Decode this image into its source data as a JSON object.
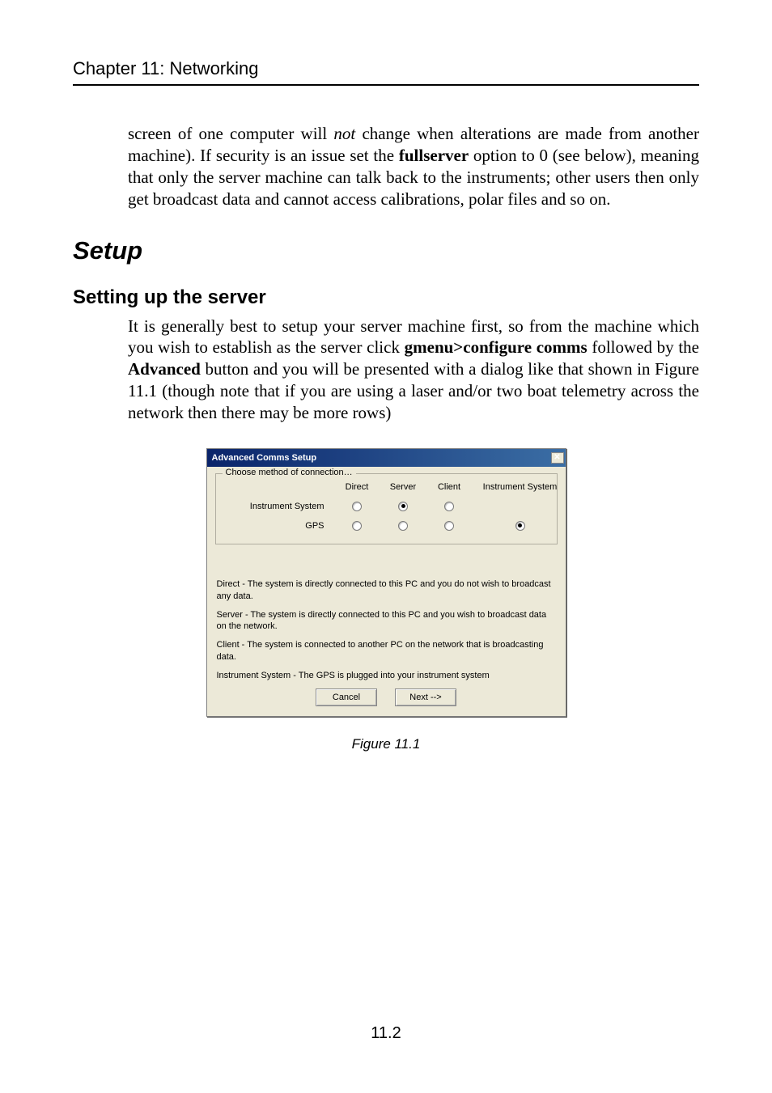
{
  "chapter_header": "Chapter 11: Networking",
  "intro": {
    "pre": "screen of one computer will ",
    "not": "not",
    "mid1": " change when alterations are made from another machine). If security is an issue set the ",
    "fullserver": "fullserver",
    "post": " option to 0 (see below), meaning that only the server machine can talk back to the instruments; other users then only get broadcast data and cannot access calibrations, polar files and so on."
  },
  "h1": "Setup",
  "h2": "Setting up the server",
  "body": {
    "pre": "It is generally best to setup your server machine first, so from the machine which you wish to establish as the server click ",
    "menu": "gmenu>configure comms",
    "mid1": " followed by the ",
    "adv": "Advanced",
    "post": " button and you will be presented with a dialog like that shown in Figure 11.1 (though note that if you are using a laser and/or two boat telemetry across the network then there may be more rows)"
  },
  "dialog": {
    "title": "Advanced Comms Setup",
    "close_glyph": "✕",
    "group_legend": "Choose method of connection…",
    "cols": {
      "c1": "Direct",
      "c2": "Server",
      "c3": "Client",
      "c4": "Instrument System"
    },
    "rows": {
      "r1_label": "Instrument System",
      "r1_selected": "server",
      "r2_label": "GPS",
      "r2_selected": "instrument_system"
    },
    "desc": {
      "d1": "Direct - The system is directly connected to this PC and you do not wish to broadcast any data.",
      "d2": "Server - The system is directly connected to this PC and you wish to broadcast data on the network.",
      "d3": "Client - The system is connected to another PC on the network that is broadcasting data.",
      "d4": "Instrument System - The GPS is plugged into your instrument system"
    },
    "buttons": {
      "cancel": "Cancel",
      "next": "Next -->"
    }
  },
  "figure_caption": "Figure 11.1",
  "page_number": "11.2"
}
